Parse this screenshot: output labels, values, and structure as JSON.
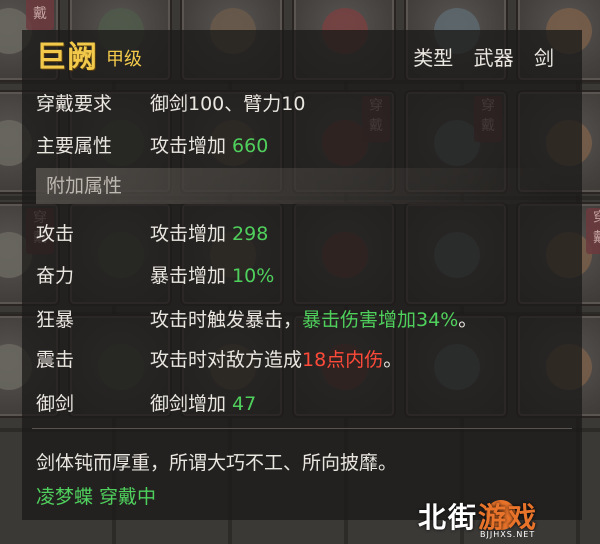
{
  "inventory": {
    "slot_tag": "穿戴",
    "slots": [
      {
        "tagged": true
      },
      {
        "tagged": false
      },
      {
        "tagged": false
      },
      {
        "tagged": false
      },
      {
        "tagged": false
      },
      {
        "tagged": false
      },
      {
        "tagged": false
      },
      {
        "tagged": false
      },
      {
        "tagged": false
      },
      {
        "tagged": true
      },
      {
        "tagged": true
      },
      {
        "tagged": false
      },
      {
        "tagged": true
      },
      {
        "tagged": false
      },
      {
        "tagged": false
      },
      {
        "tagged": false
      },
      {
        "tagged": false
      },
      {
        "tagged": true
      },
      {
        "tagged": false
      },
      {
        "tagged": false
      },
      {
        "tagged": false
      },
      {
        "tagged": false
      },
      {
        "tagged": false
      },
      {
        "tagged": false
      }
    ]
  },
  "tooltip": {
    "name": "巨阙",
    "grade": "甲级",
    "type": "类型  武器 剑",
    "requirement": {
      "label": "穿戴要求",
      "value": "御剑100、臂力10"
    },
    "main_attr": {
      "label": "主要属性",
      "text": "攻击增加 ",
      "num": "660"
    },
    "extra_header": "附加属性",
    "extra": [
      {
        "label": "攻击",
        "text": "攻击增加 ",
        "num": "298"
      },
      {
        "label": "奋力",
        "text": "暴击增加 ",
        "num": "10%"
      },
      {
        "label": "狂暴",
        "text": "攻击时触发暴击，",
        "hl": "暴击伤害增加34%",
        "tail": "。"
      },
      {
        "label": "震击",
        "text": "攻击时对敌方造成",
        "hl": "18点内伤",
        "tail": "。"
      },
      {
        "label": "御剑",
        "text": "御剑增加 ",
        "num": "47"
      }
    ],
    "description": "剑体钝而厚重，所谓大巧不工、所向披靡。",
    "wear_status": "凌梦蝶 穿戴中"
  },
  "watermark": {
    "part1": "北街",
    "part2": "游戏",
    "url": "BJJHXS.NET"
  },
  "colors": {
    "name_gold": "#f2c94a",
    "value_green": "#4fd05c",
    "highlight_red": "#ff4a3a"
  }
}
